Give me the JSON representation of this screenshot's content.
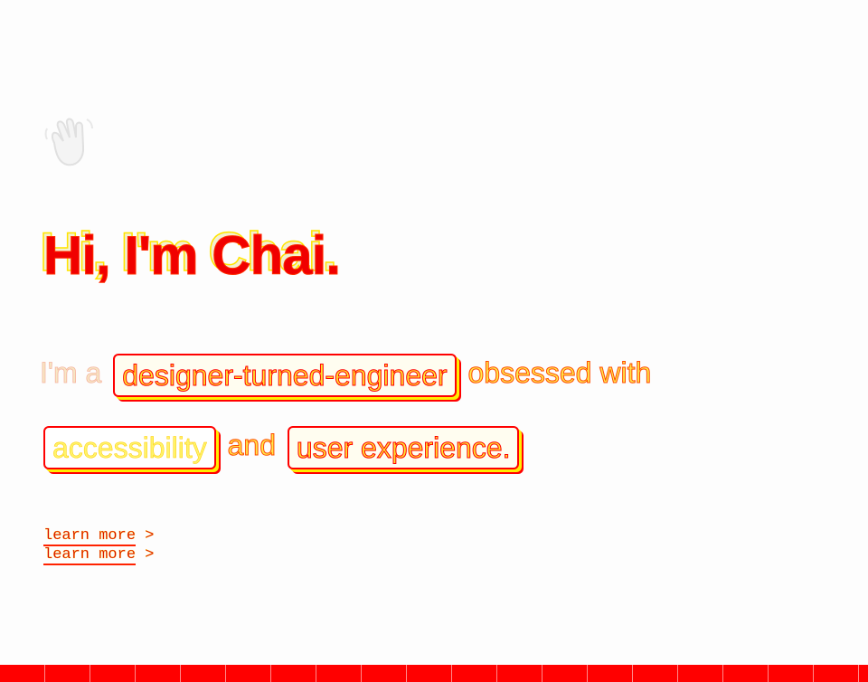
{
  "hero": {
    "wave_icon": "waving-hand-icon",
    "greeting": "Hi, I'm Chai.",
    "intro": {
      "prefix": "I'm a",
      "role": "designer-turned-engineer",
      "middle": "obsessed with",
      "topic_one": "accessibility",
      "joiner": "and",
      "topic_two": "user experience."
    },
    "cta": {
      "label": "learn more",
      "chevron": ">"
    }
  },
  "colors": {
    "accent": "#ff0000",
    "highlight": "#ffee00",
    "background": "#fdfdfd"
  }
}
